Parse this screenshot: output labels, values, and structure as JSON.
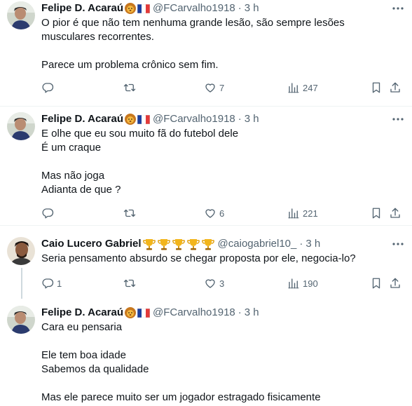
{
  "tweets": [
    {
      "name": "Felipe D. Acaraú",
      "handle": "@FCarvalho1918",
      "time": "3 h",
      "lines": [
        "O pior é que não tem nenhuma grande lesão, são sempre lesões",
        "musculares recorrentes.",
        "",
        "Parece um problema crônico sem fim."
      ],
      "replies": "",
      "retweets": "",
      "likes": "7",
      "views": "247"
    },
    {
      "name": "Felipe D. Acaraú",
      "handle": "@FCarvalho1918",
      "time": "3 h",
      "lines": [
        "E olhe que eu sou muito fã do futebol dele",
        "É um craque",
        "",
        "Mas não joga",
        "Adianta de que ?"
      ],
      "replies": "",
      "retweets": "",
      "likes": "6",
      "views": "221"
    },
    {
      "name": "Caio Lucero Gabriel",
      "handle": "@caiogabriel10_",
      "time": "3 h",
      "lines": [
        "Seria pensamento absurdo se chegar proposta por ele, negocia-lo?"
      ],
      "replies": "1",
      "retweets": "",
      "likes": "3",
      "views": "190"
    },
    {
      "name": "Felipe D. Acaraú",
      "handle": "@FCarvalho1918",
      "time": "3 h",
      "lines": [
        "Cara eu pensaria",
        "",
        "Ele tem boa idade",
        "Sabemos da qualidade",
        "",
        "Mas ele parece muito ser um jogador estragado fisicamente"
      ]
    }
  ],
  "separator": "·",
  "icons": {
    "badge_felipe": [
      "lion-face-icon",
      "france-flag-icon"
    ],
    "badge_caio": [
      "trophy-icon",
      "trophy-icon",
      "trophy-icon",
      "trophy-icon",
      "trophy-icon"
    ],
    "actions": [
      "reply-icon",
      "retweet-icon",
      "like-icon",
      "views-icon",
      "bookmark-icon",
      "share-icon"
    ]
  },
  "colors": {
    "text": "#0f1419",
    "secondary": "#536471",
    "divider": "#eff3f4",
    "thread_line": "#cfd9de"
  }
}
